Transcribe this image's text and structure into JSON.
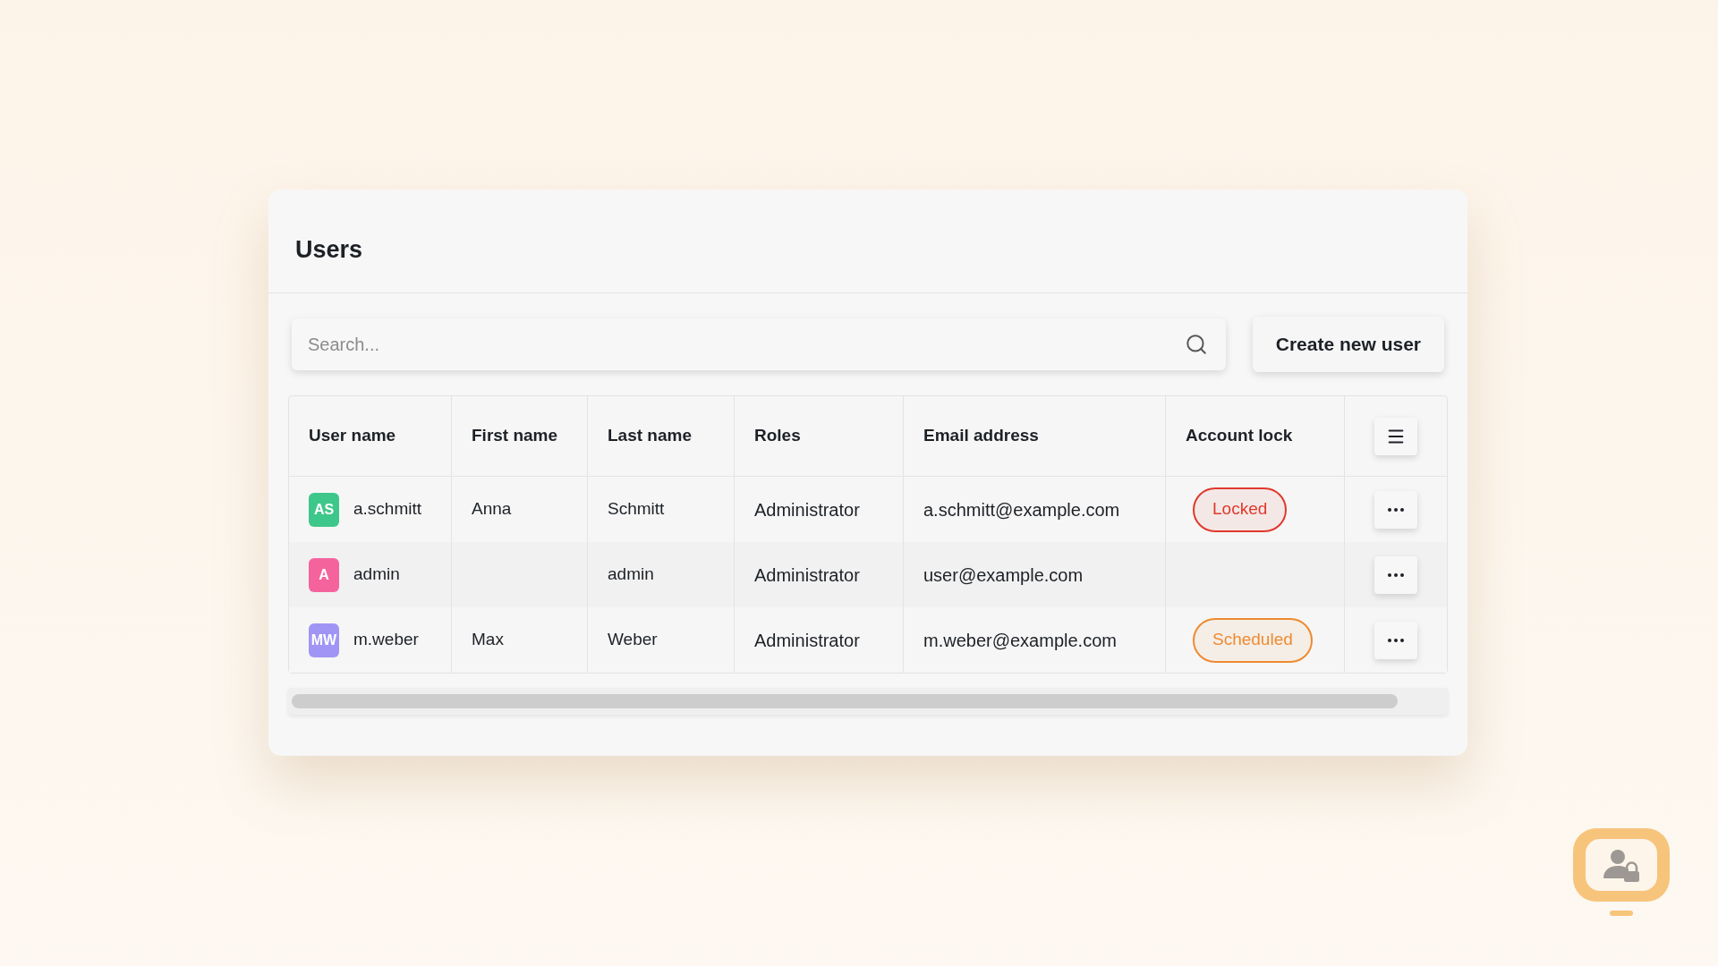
{
  "header": {
    "title": "Users"
  },
  "toolbar": {
    "search": {
      "placeholder": "Search..."
    },
    "create_button": "Create new user"
  },
  "table": {
    "columns": [
      "User name",
      "First name",
      "Last name",
      "Roles",
      "Email address",
      "Account lock"
    ],
    "rows": [
      {
        "user_name": "a.schmitt",
        "initials": "AS",
        "color": "#3ec78a",
        "first_name": "Anna",
        "last_name": "Schmitt",
        "roles": "Administrator",
        "email": "a.schmitt@example.com",
        "account_lock": {
          "label": "Locked",
          "color": "#e0392b"
        }
      },
      {
        "user_name": "admin",
        "initials": "A",
        "color": "#f5639d",
        "last_name": "admin",
        "roles": "Administrator",
        "email": "user@example.com"
      },
      {
        "user_name": "m.weber",
        "initials": "MW",
        "color": "#a095f5",
        "first_name": "Max",
        "last_name": "Weber",
        "roles": "Administrator",
        "email": "m.weber@example.com",
        "account_lock": {
          "label": "Scheduled",
          "color": "#ee8a30"
        }
      }
    ]
  }
}
